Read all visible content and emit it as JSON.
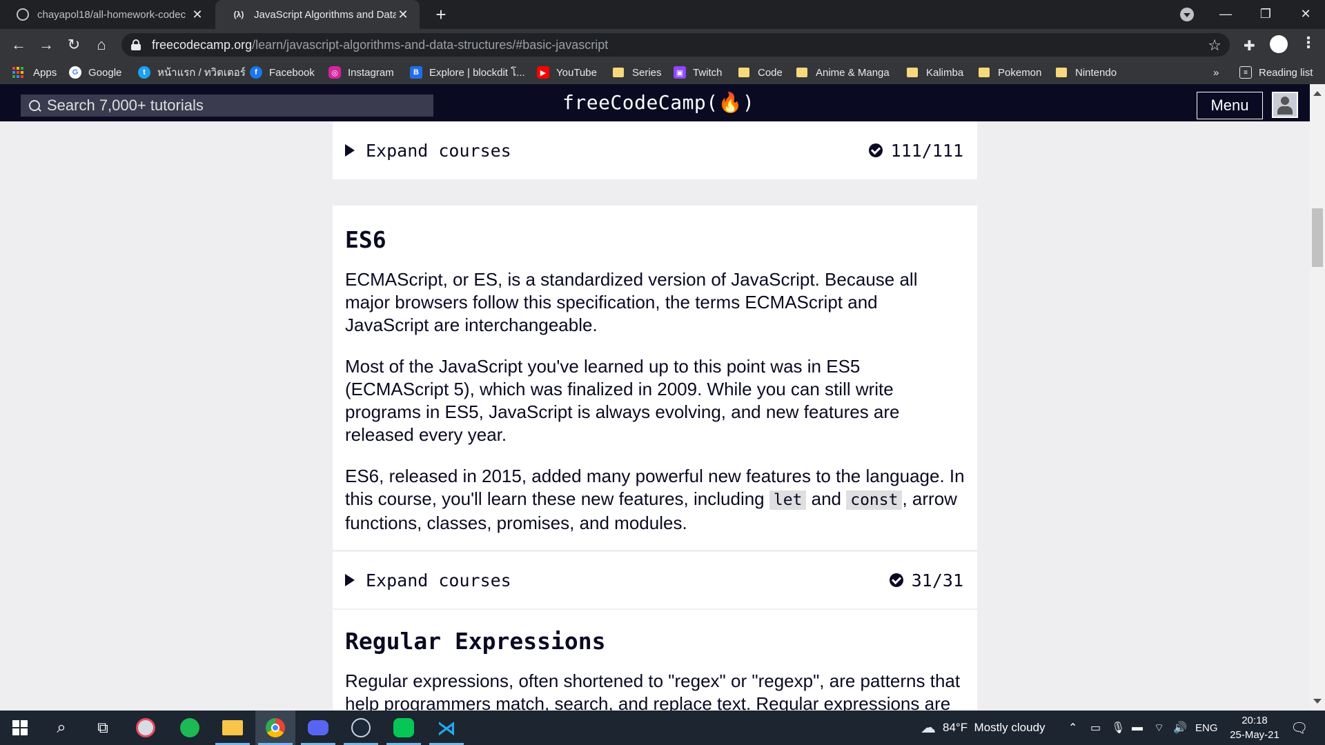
{
  "browser": {
    "tabs": [
      {
        "title": "chayapol18/all-homework-codec",
        "favicon": "github-icon",
        "active": false
      },
      {
        "title": "JavaScript Algorithms and Data S",
        "favicon": "freecodecamp-icon",
        "active": true
      }
    ],
    "url_host": "freecodecamp.org",
    "url_path": "/learn/javascript-algorithms-and-data-structures/#basic-javascript",
    "more_bookmarks": "»"
  },
  "bookmarks": [
    {
      "label": "Apps",
      "icon": "apps-grid-icon"
    },
    {
      "label": "Google",
      "icon": "google-icon"
    },
    {
      "label": "หน้าแรก / ทวิตเตอร์",
      "icon": "twitter-icon"
    },
    {
      "label": "Facebook",
      "icon": "facebook-icon"
    },
    {
      "label": "Instagram",
      "icon": "instagram-icon"
    },
    {
      "label": "Explore | blockdit โ...",
      "icon": "blockdit-icon"
    },
    {
      "label": "YouTube",
      "icon": "youtube-icon"
    },
    {
      "label": "Series",
      "icon": "folder-icon"
    },
    {
      "label": "Twitch",
      "icon": "twitch-icon"
    },
    {
      "label": "Code",
      "icon": "folder-icon"
    },
    {
      "label": "Anime & Manga",
      "icon": "folder-icon"
    },
    {
      "label": "Kalimba",
      "icon": "folder-icon"
    },
    {
      "label": "Pokemon",
      "icon": "folder-icon"
    },
    {
      "label": "Nintendo",
      "icon": "folder-icon"
    },
    {
      "label": "Reading list",
      "icon": "reading-list-icon"
    }
  ],
  "fcc": {
    "search_placeholder": "Search 7,000+ tutorials",
    "logo": "freeCodeCamp(🔥)",
    "menu": "Menu"
  },
  "content": {
    "expand_label": "Expand courses",
    "top_progress": "111/111",
    "es6": {
      "title": "ES6",
      "p1": "ECMAScript, or ES, is a standardized version of JavaScript. Because all major browsers follow this specification, the terms ECMAScript and JavaScript are interchangeable.",
      "p2": "Most of the JavaScript you've learned up to this point was in ES5 (ECMAScript 5), which was finalized in 2009. While you can still write programs in ES5, JavaScript is always evolving, and new features are released every year.",
      "p3_a": "ES6, released in 2015, added many powerful new features to the language. In this course, you'll learn these new features, including ",
      "p3_code1": "let",
      "p3_b": " and ",
      "p3_code2": "const",
      "p3_c": ", arrow functions, classes, promises, and modules.",
      "progress": "31/31"
    },
    "regex": {
      "title": "Regular Expressions",
      "p1": "Regular expressions, often shortened to \"regex\" or \"regexp\", are patterns that help programmers match, search, and replace text. Regular expressions are"
    }
  },
  "taskbar": {
    "apps": [
      "windows-start-icon",
      "search-icon",
      "task-view-icon",
      "paint-icon",
      "spotify-icon",
      "file-explorer-icon",
      "chrome-icon",
      "discord-icon",
      "steam-icon",
      "line-icon",
      "vscode-icon"
    ],
    "weather": "84°F  Mostly cloudy",
    "lang": "ENG",
    "time": "20:18",
    "date": "25-May-21"
  }
}
